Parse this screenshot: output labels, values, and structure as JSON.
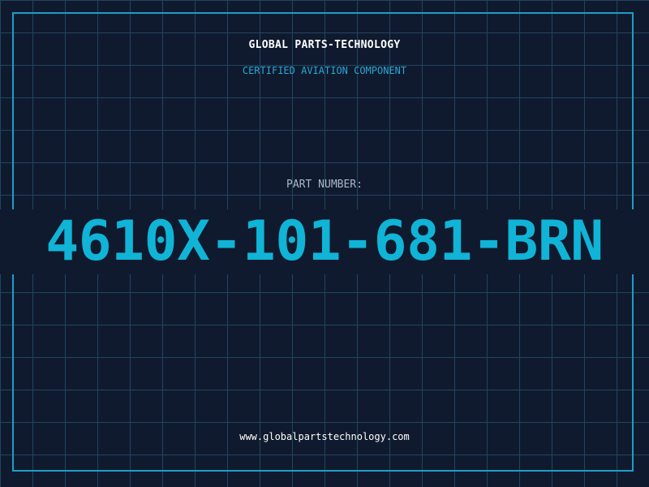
{
  "header": {
    "company": "GLOBAL PARTS-TECHNOLOGY",
    "subtitle": "CERTIFIED AVIATION COMPONENT"
  },
  "part": {
    "label": "PART NUMBER:",
    "number": "4610X-101-681-BRN"
  },
  "footer": {
    "url": "www.globalpartstechnology.com"
  },
  "colors": {
    "background": "#101a2e",
    "grid": "#1f4660",
    "accent": "#10b4d6",
    "frame": "#1c9ec9"
  }
}
